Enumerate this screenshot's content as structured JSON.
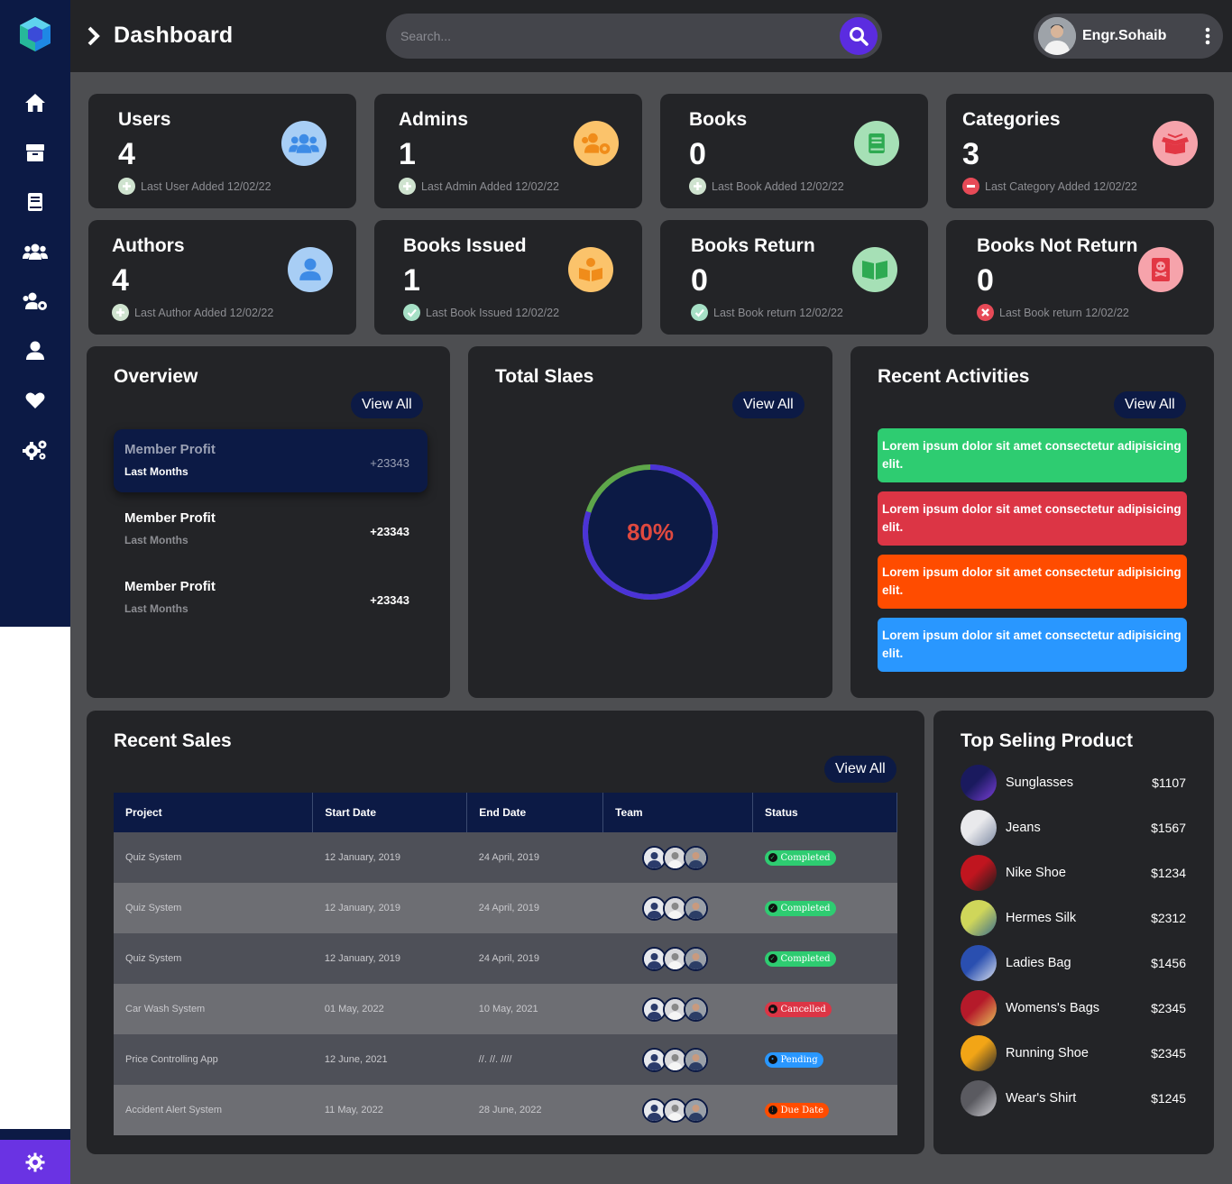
{
  "header": {
    "title": "Dashboard",
    "search_placeholder": "Search...",
    "user_name": "Engr.Sohaib"
  },
  "sidebar": {
    "items": [
      "home-icon",
      "box-icon",
      "book-icon",
      "users-icon",
      "users-cog-icon",
      "user-icon",
      "heart-icon",
      "cogs-icon"
    ],
    "bottom": "settings-icon"
  },
  "stats": [
    {
      "title": "Users",
      "value": "4",
      "foot": "Last User Added 12/02/22",
      "icon": "users-icon",
      "icon_bg": "#a8cef5",
      "foot_icon": "plus-circle",
      "foot_color": "#cfe3cf"
    },
    {
      "title": "Admins",
      "value": "1",
      "foot": "Last Admin Added 12/02/22",
      "icon": "users-cog-icon",
      "icon_bg": "#fbc36b",
      "foot_icon": "plus-circle",
      "foot_color": "#cfe3cf"
    },
    {
      "title": "Books",
      "value": "0",
      "foot": "Last Book Added 12/02/22",
      "icon": "book-icon",
      "icon_bg": "#a6e0b6",
      "foot_icon": "plus-circle",
      "foot_color": "#cfe3cf"
    },
    {
      "title": "Categories",
      "value": "3",
      "foot": "Last Category Added 12/02/22",
      "icon": "box-open-icon",
      "icon_bg": "#f6a3ab",
      "foot_icon": "minus-circle",
      "foot_color": "#e74a57"
    },
    {
      "title": "Authors",
      "value": "4",
      "foot": "Last Author Added 12/02/22",
      "icon": "user-icon",
      "icon_bg": "#a8cef5",
      "foot_icon": "plus-circle",
      "foot_color": "#cfe3cf"
    },
    {
      "title": "Books Issued",
      "value": "1",
      "foot": "Last Book Issued 12/02/22",
      "icon": "book-reader-icon",
      "icon_bg": "#fbc36b",
      "foot_icon": "check-circle",
      "foot_color": "#a6e0c6"
    },
    {
      "title": "Books Return",
      "value": "0",
      "foot": "Last Book return 12/02/22",
      "icon": "book-open-icon",
      "icon_bg": "#a6e0b6",
      "foot_icon": "check-circle",
      "foot_color": "#a6e0c6"
    },
    {
      "title": "Books Not Return",
      "value": "0",
      "foot": "Last Book return 12/02/22",
      "icon": "skull-book-icon",
      "icon_bg": "#f6a3ab",
      "foot_icon": "times-circle",
      "foot_color": "#e74a57"
    }
  ],
  "overview": {
    "title": "Overview",
    "view_all": "View All",
    "items": [
      {
        "title": "Member Profit",
        "sub": "Last Months",
        "value": "+23343"
      },
      {
        "title": "Member Profit",
        "sub": "Last Months",
        "value": "+23343"
      },
      {
        "title": "Member Profit",
        "sub": "Last Months",
        "value": "+23343"
      }
    ]
  },
  "sales_gauge": {
    "title": "Total Slaes",
    "view_all": "View All",
    "percent_label": "80%",
    "percent": 80
  },
  "activities": {
    "title": "Recent Activities",
    "view_all": "View All",
    "items": [
      {
        "text": "Lorem ipsum dolor sit amet consectetur adipisicing elit.",
        "color": "#2ecc71"
      },
      {
        "text": "Lorem ipsum dolor sit amet consectetur adipisicing elit.",
        "color": "#dc3545"
      },
      {
        "text": "Lorem ipsum dolor sit amet consectetur adipisicing elit.",
        "color": "#ff4c00"
      },
      {
        "text": "Lorem ipsum dolor sit amet consectetur adipisicing elit.",
        "color": "#2997ff"
      }
    ]
  },
  "recent_sales": {
    "title": "Recent Sales",
    "view_all": "View All",
    "columns": [
      "Project",
      "Start Date",
      "End Date",
      "Team",
      "Status"
    ],
    "rows": [
      {
        "project": "Quiz System",
        "start": "12 January, 2019",
        "end": "24 April, 2019",
        "status": "Completed",
        "status_color": "#2ecc71",
        "status_icon": "✓"
      },
      {
        "project": "Quiz System",
        "start": "12 January, 2019",
        "end": "24 April, 2019",
        "status": "Completed",
        "status_color": "#2ecc71",
        "status_icon": "✓"
      },
      {
        "project": "Quiz System",
        "start": "12 January, 2019",
        "end": "24 April, 2019",
        "status": "Completed",
        "status_color": "#2ecc71",
        "status_icon": "✓"
      },
      {
        "project": "Car Wash System",
        "start": "01 May, 2022",
        "end": "10 May, 2021",
        "status": "Cancelled",
        "status_color": "#dc3545",
        "status_icon": "▪"
      },
      {
        "project": "Price Controlling App",
        "start": "12 June, 2021",
        "end": "//. //. ////",
        "status": "Pending",
        "status_color": "#2997ff",
        "status_icon": "•"
      },
      {
        "project": "Accident Alert System",
        "start": "11 May, 2022",
        "end": "28 June, 2022",
        "status": "Due Date",
        "status_color": "#ff4c00",
        "status_icon": "!"
      }
    ]
  },
  "top_products": {
    "title": "Top Seling Product",
    "items": [
      {
        "name": "Sunglasses",
        "price": "$1107",
        "c1": "#1a1a5e",
        "c2": "#7b3fd8"
      },
      {
        "name": "Jeans",
        "price": "$1567",
        "c1": "#e9e9ec",
        "c2": "#7d8aa3"
      },
      {
        "name": "Nike Shoe",
        "price": "$1234",
        "c1": "#c0151f",
        "c2": "#1b1b1b"
      },
      {
        "name": "Hermes Silk",
        "price": "$2312",
        "c1": "#cfd65a",
        "c2": "#3b6e8c"
      },
      {
        "name": "Ladies Bag",
        "price": "$1456",
        "c1": "#2a4fb0",
        "c2": "#dbe1ee"
      },
      {
        "name": "Womens's Bags",
        "price": "$2345",
        "c1": "#b51a2a",
        "c2": "#e8c45a"
      },
      {
        "name": "Running Shoe",
        "price": "$2345",
        "c1": "#f2a516",
        "c2": "#2b2b2b"
      },
      {
        "name": "Wear's Shirt",
        "price": "$1245",
        "c1": "#5a5a60",
        "c2": "#cfcfd4"
      }
    ]
  }
}
